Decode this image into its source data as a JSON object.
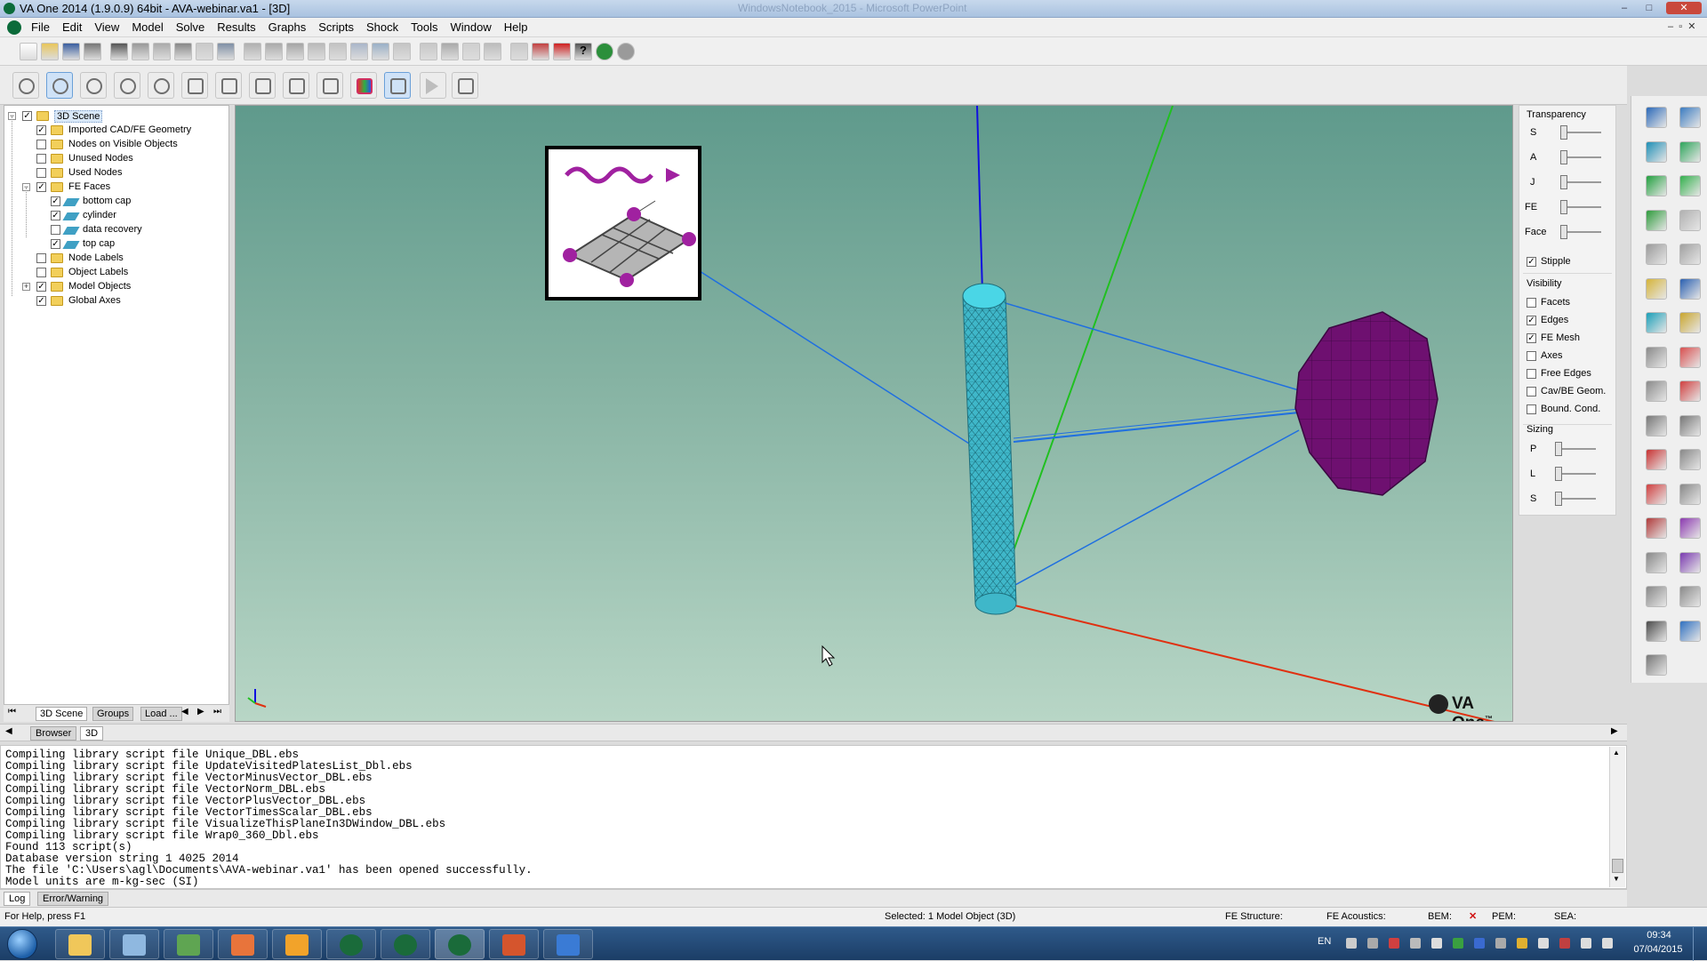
{
  "titlebar": {
    "title": "VA One 2014 (1.9.0.9) 64bit - AVA-webinar.va1 - [3D]",
    "background_window": "WindowsNotebook_2015 - Microsoft PowerPoint"
  },
  "menu": [
    "File",
    "Edit",
    "View",
    "Model",
    "Solve",
    "Results",
    "Graphs",
    "Scripts",
    "Shock",
    "Tools",
    "Window",
    "Help"
  ],
  "tree": {
    "items": [
      {
        "label": "3D Scene",
        "level": 0,
        "expand": "-",
        "checked": true,
        "icon": "folder-icon",
        "selected": true
      },
      {
        "label": "Imported CAD/FE Geometry",
        "level": 1,
        "expand": "",
        "checked": true,
        "icon": "folder-icon"
      },
      {
        "label": "Nodes on Visible Objects",
        "level": 1,
        "expand": "",
        "checked": false,
        "icon": "folder-icon"
      },
      {
        "label": "Unused Nodes",
        "level": 1,
        "expand": "",
        "checked": false,
        "icon": "folder-icon"
      },
      {
        "label": "Used Nodes",
        "level": 1,
        "expand": "",
        "checked": false,
        "icon": "folder-icon"
      },
      {
        "label": "FE Faces",
        "level": 1,
        "expand": "-",
        "checked": true,
        "icon": "folder-icon"
      },
      {
        "label": "bottom cap",
        "level": 2,
        "expand": "",
        "checked": true,
        "icon": "fe-face-icon"
      },
      {
        "label": "cylinder",
        "level": 2,
        "expand": "",
        "checked": true,
        "icon": "fe-face-icon"
      },
      {
        "label": "data recovery",
        "level": 2,
        "expand": "",
        "checked": false,
        "icon": "fe-face-icon"
      },
      {
        "label": "top cap",
        "level": 2,
        "expand": "",
        "checked": true,
        "icon": "fe-face-icon"
      },
      {
        "label": "Node Labels",
        "level": 1,
        "expand": "",
        "checked": false,
        "icon": "folder-icon"
      },
      {
        "label": "Object Labels",
        "level": 1,
        "expand": "",
        "checked": false,
        "icon": "folder-icon"
      },
      {
        "label": "Model Objects",
        "level": 1,
        "expand": "+",
        "checked": true,
        "icon": "folder-icon"
      },
      {
        "label": "Global Axes",
        "level": 1,
        "expand": "",
        "checked": true,
        "icon": "folder-icon"
      }
    ],
    "tabs": [
      "3D Scene",
      "Groups",
      "Load ..."
    ]
  },
  "viewport": {
    "logo_text": "VA One",
    "logo_mark": "™"
  },
  "properties": {
    "transparency_title": "Transparency",
    "transparency_sliders": [
      "S",
      "A",
      "J",
      "FE",
      "Face"
    ],
    "stipple": {
      "label": "Stipple",
      "checked": true
    },
    "visibility_title": "Visibility",
    "visibility": [
      {
        "label": "Facets",
        "checked": false
      },
      {
        "label": "Edges",
        "checked": true
      },
      {
        "label": "FE Mesh",
        "checked": true
      },
      {
        "label": "Axes",
        "checked": false
      },
      {
        "label": "Free Edges",
        "checked": false
      },
      {
        "label": "Cav/BE Geom.",
        "checked": false
      },
      {
        "label": "Bound. Cond.",
        "checked": false
      }
    ],
    "sizing_title": "Sizing",
    "sizing_sliders": [
      "P",
      "L",
      "S"
    ]
  },
  "view_tabs": [
    "Browser",
    "3D"
  ],
  "log": {
    "lines": [
      "Compiling library script file Unique_DBL.ebs",
      "Compiling library script file UpdateVisitedPlatesList_Dbl.ebs",
      "Compiling library script file VectorMinusVector_DBL.ebs",
      "Compiling library script file VectorNorm_DBL.ebs",
      "Compiling library script file VectorPlusVector_DBL.ebs",
      "Compiling library script file VectorTimesScalar_DBL.ebs",
      "Compiling library script file VisualizeThisPlaneIn3DWindow_DBL.ebs",
      "Compiling library script file Wrap0_360_Dbl.ebs",
      "Found 113 script(s)",
      "Database version string 1 4025 2014",
      "The file 'C:\\Users\\agl\\Documents\\AVA-webinar.va1' has been opened successfully.",
      "Model units are m-kg-sec (SI)"
    ],
    "tabs": [
      "Log",
      "Error/Warning"
    ]
  },
  "status": {
    "help": "For Help, press F1",
    "selected": "Selected: 1 Model Object (3D)",
    "fe_structure": "FE Structure:",
    "fe_acoustics": "FE Acoustics:",
    "bem": "BEM:",
    "bem_mark": "✕",
    "pem": "PEM:",
    "sea": "SEA:"
  },
  "taskbar": {
    "lang": "EN",
    "time": "09:34",
    "date": "07/04/2015",
    "apps": [
      "start-orb",
      "file-explorer",
      "notepad",
      "spreadsheet-app",
      "firefox",
      "outlook",
      "va-one-1",
      "va-one-2",
      "va-one-3",
      "powerpoint",
      "settings-app"
    ]
  },
  "colors": {
    "viewport_top": "#5f9a8c",
    "viewport_bottom": "#b8d6c6",
    "cylinder": "#3fb7c9",
    "sphere": "#6e1070",
    "axis_x": "#e03010",
    "axis_y": "#20c020",
    "axis_z": "#1010e0",
    "connections": "#1f6fe0"
  }
}
